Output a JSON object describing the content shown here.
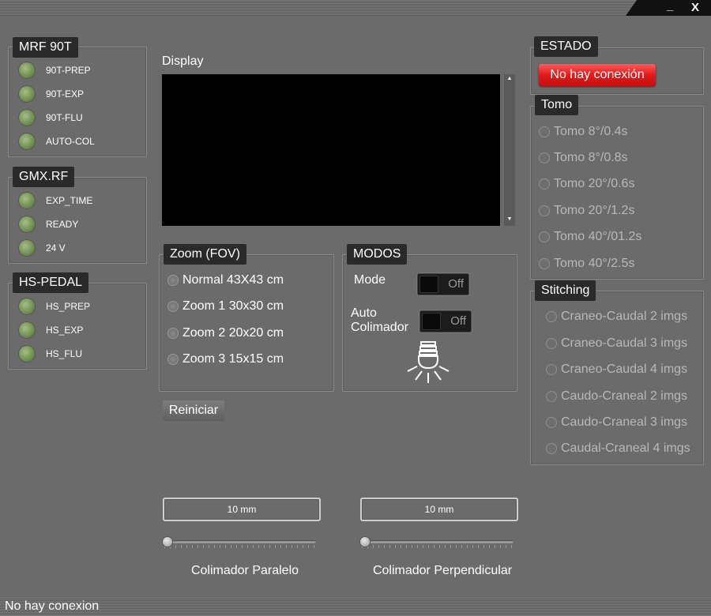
{
  "window": {
    "minimize_label": "_",
    "close_label": "X"
  },
  "mrf": {
    "title": "MRF 90T",
    "leds": [
      {
        "label": "90T-PREP"
      },
      {
        "label": "90T-EXP"
      },
      {
        "label": "90T-FLU"
      },
      {
        "label": "AUTO-COL"
      }
    ]
  },
  "gmx": {
    "title": "GMX.RF",
    "leds": [
      {
        "label": "EXP_TIME"
      },
      {
        "label": "READY"
      },
      {
        "label": "24 V"
      }
    ]
  },
  "hs_pedal": {
    "title": "HS-PEDAL",
    "leds": [
      {
        "label": "HS_PREP"
      },
      {
        "label": "HS_EXP"
      },
      {
        "label": "HS_FLU"
      }
    ]
  },
  "display": {
    "label": "Display"
  },
  "zoom": {
    "title": "Zoom (FOV)",
    "options": [
      {
        "label": "Normal 43X43 cm"
      },
      {
        "label": "Zoom 1 30x30 cm"
      },
      {
        "label": "Zoom 2 20x20 cm"
      },
      {
        "label": "Zoom 3 15x15 cm"
      }
    ]
  },
  "reset_button": "Reiniciar",
  "modos": {
    "title": "MODOS",
    "mode_label": "Mode",
    "mode_toggle": "Off",
    "auto_label_line1": "Auto",
    "auto_label_line2": "Colimador",
    "auto_toggle": "Off",
    "icon": "collimator-lamp-icon"
  },
  "estado": {
    "title": "ESTADO",
    "status_button": "No hay conexión",
    "status_color": "#e21b1b"
  },
  "tomo": {
    "title": "Tomo",
    "options": [
      {
        "label": "Tomo 8°/0.4s"
      },
      {
        "label": "Tomo 8°/0.8s"
      },
      {
        "label": "Tomo 20°/0.6s"
      },
      {
        "label": "Tomo 20°/1.2s"
      },
      {
        "label": "Tomo 40°/01.2s"
      },
      {
        "label": "Tomo 40°/2.5s"
      }
    ]
  },
  "stitching": {
    "title": "Stitching",
    "options": [
      {
        "label": "Craneo-Caudal 2 imgs"
      },
      {
        "label": "Craneo-Caudal 3 imgs"
      },
      {
        "label": "Craneo-Caudal 4 imgs"
      },
      {
        "label": "Caudo-Craneal 2 imgs"
      },
      {
        "label": "Caudo-Craneal 3 imgs"
      },
      {
        "label": "Caudal-Craneal 4 imgs"
      }
    ]
  },
  "collimators": [
    {
      "value": "10 mm",
      "caption": "Colimador Paralelo",
      "slider_fraction": 0
    },
    {
      "value": "10 mm",
      "caption": "Colimador Perpendicular",
      "slider_fraction": 0
    }
  ],
  "statusbar": {
    "text": "No hay conexion"
  }
}
